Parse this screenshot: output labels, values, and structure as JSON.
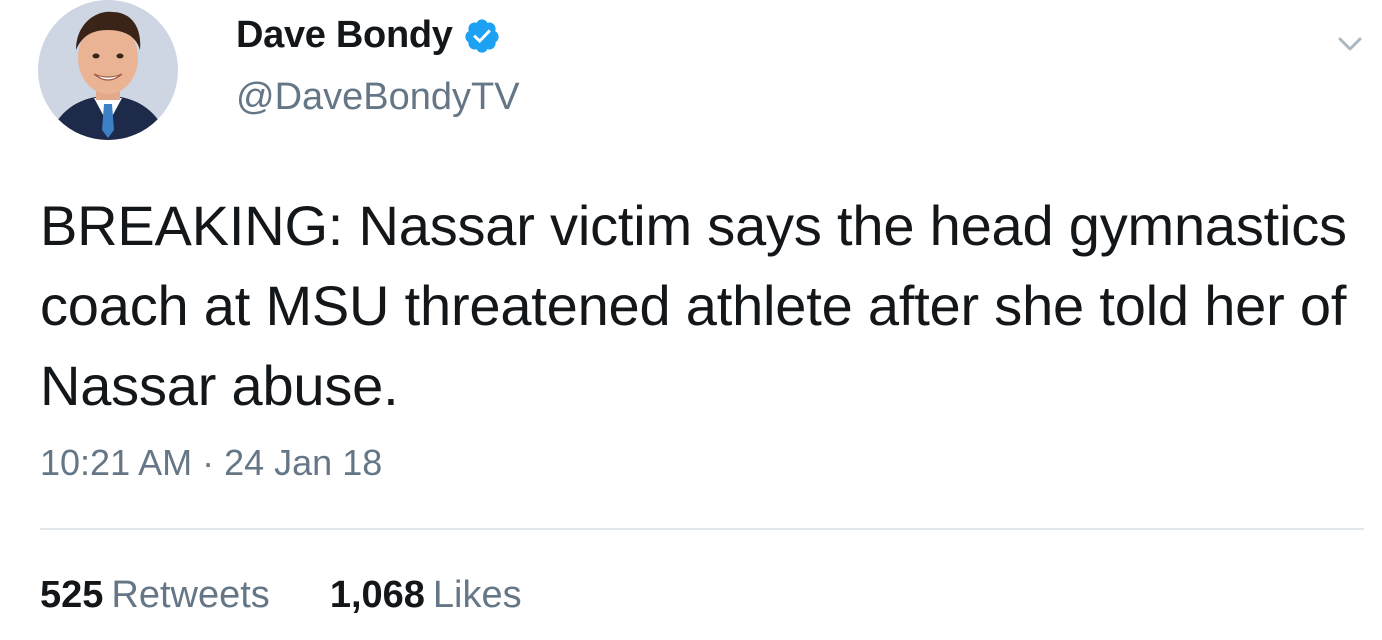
{
  "user": {
    "display_name": "Dave Bondy",
    "handle": "@DaveBondyTV",
    "verified": true,
    "avatar_icon": "profile-photo"
  },
  "tweet": {
    "text": "BREAKING: Nassar victim says the head gymnastics coach at MSU threatened athlete after she told her of Nassar abuse.",
    "time": "10:21 AM",
    "separator": "·",
    "date": "24 Jan 18"
  },
  "stats": {
    "retweets_count": "525",
    "retweets_label": "Retweets",
    "likes_count": "1,068",
    "likes_label": "Likes"
  },
  "icons": {
    "verified": "verified-badge-icon",
    "caret": "chevron-down-icon"
  },
  "colors": {
    "verified_blue": "#1da1f2",
    "text_primary": "#14171a",
    "text_secondary": "#657786",
    "divider": "#e1e8ed"
  }
}
